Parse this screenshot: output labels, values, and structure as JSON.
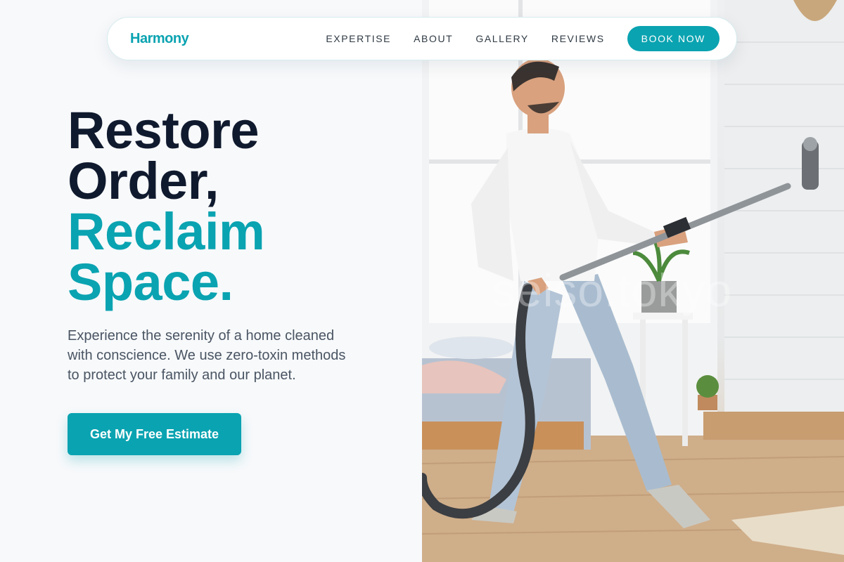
{
  "nav": {
    "brand": "Harmony",
    "links": [
      "EXPERTISE",
      "ABOUT",
      "GALLERY",
      "REVIEWS"
    ],
    "cta": "BOOK NOW"
  },
  "hero": {
    "headline_line1": "Restore",
    "headline_line2": "Order,",
    "headline_line3": "Reclaim",
    "headline_line4": "Space.",
    "lead": "Experience the serenity of a home cleaned with conscience. We use zero-toxin methods to protect your family and our planet.",
    "cta": "Get My Free Estimate"
  },
  "photo": {
    "watermark": "seiso.tokyo"
  },
  "colors": {
    "accent": "#0aa3b1",
    "heading": "#101a2e",
    "body_text": "#4a5563",
    "background": "#f7f9fb"
  }
}
